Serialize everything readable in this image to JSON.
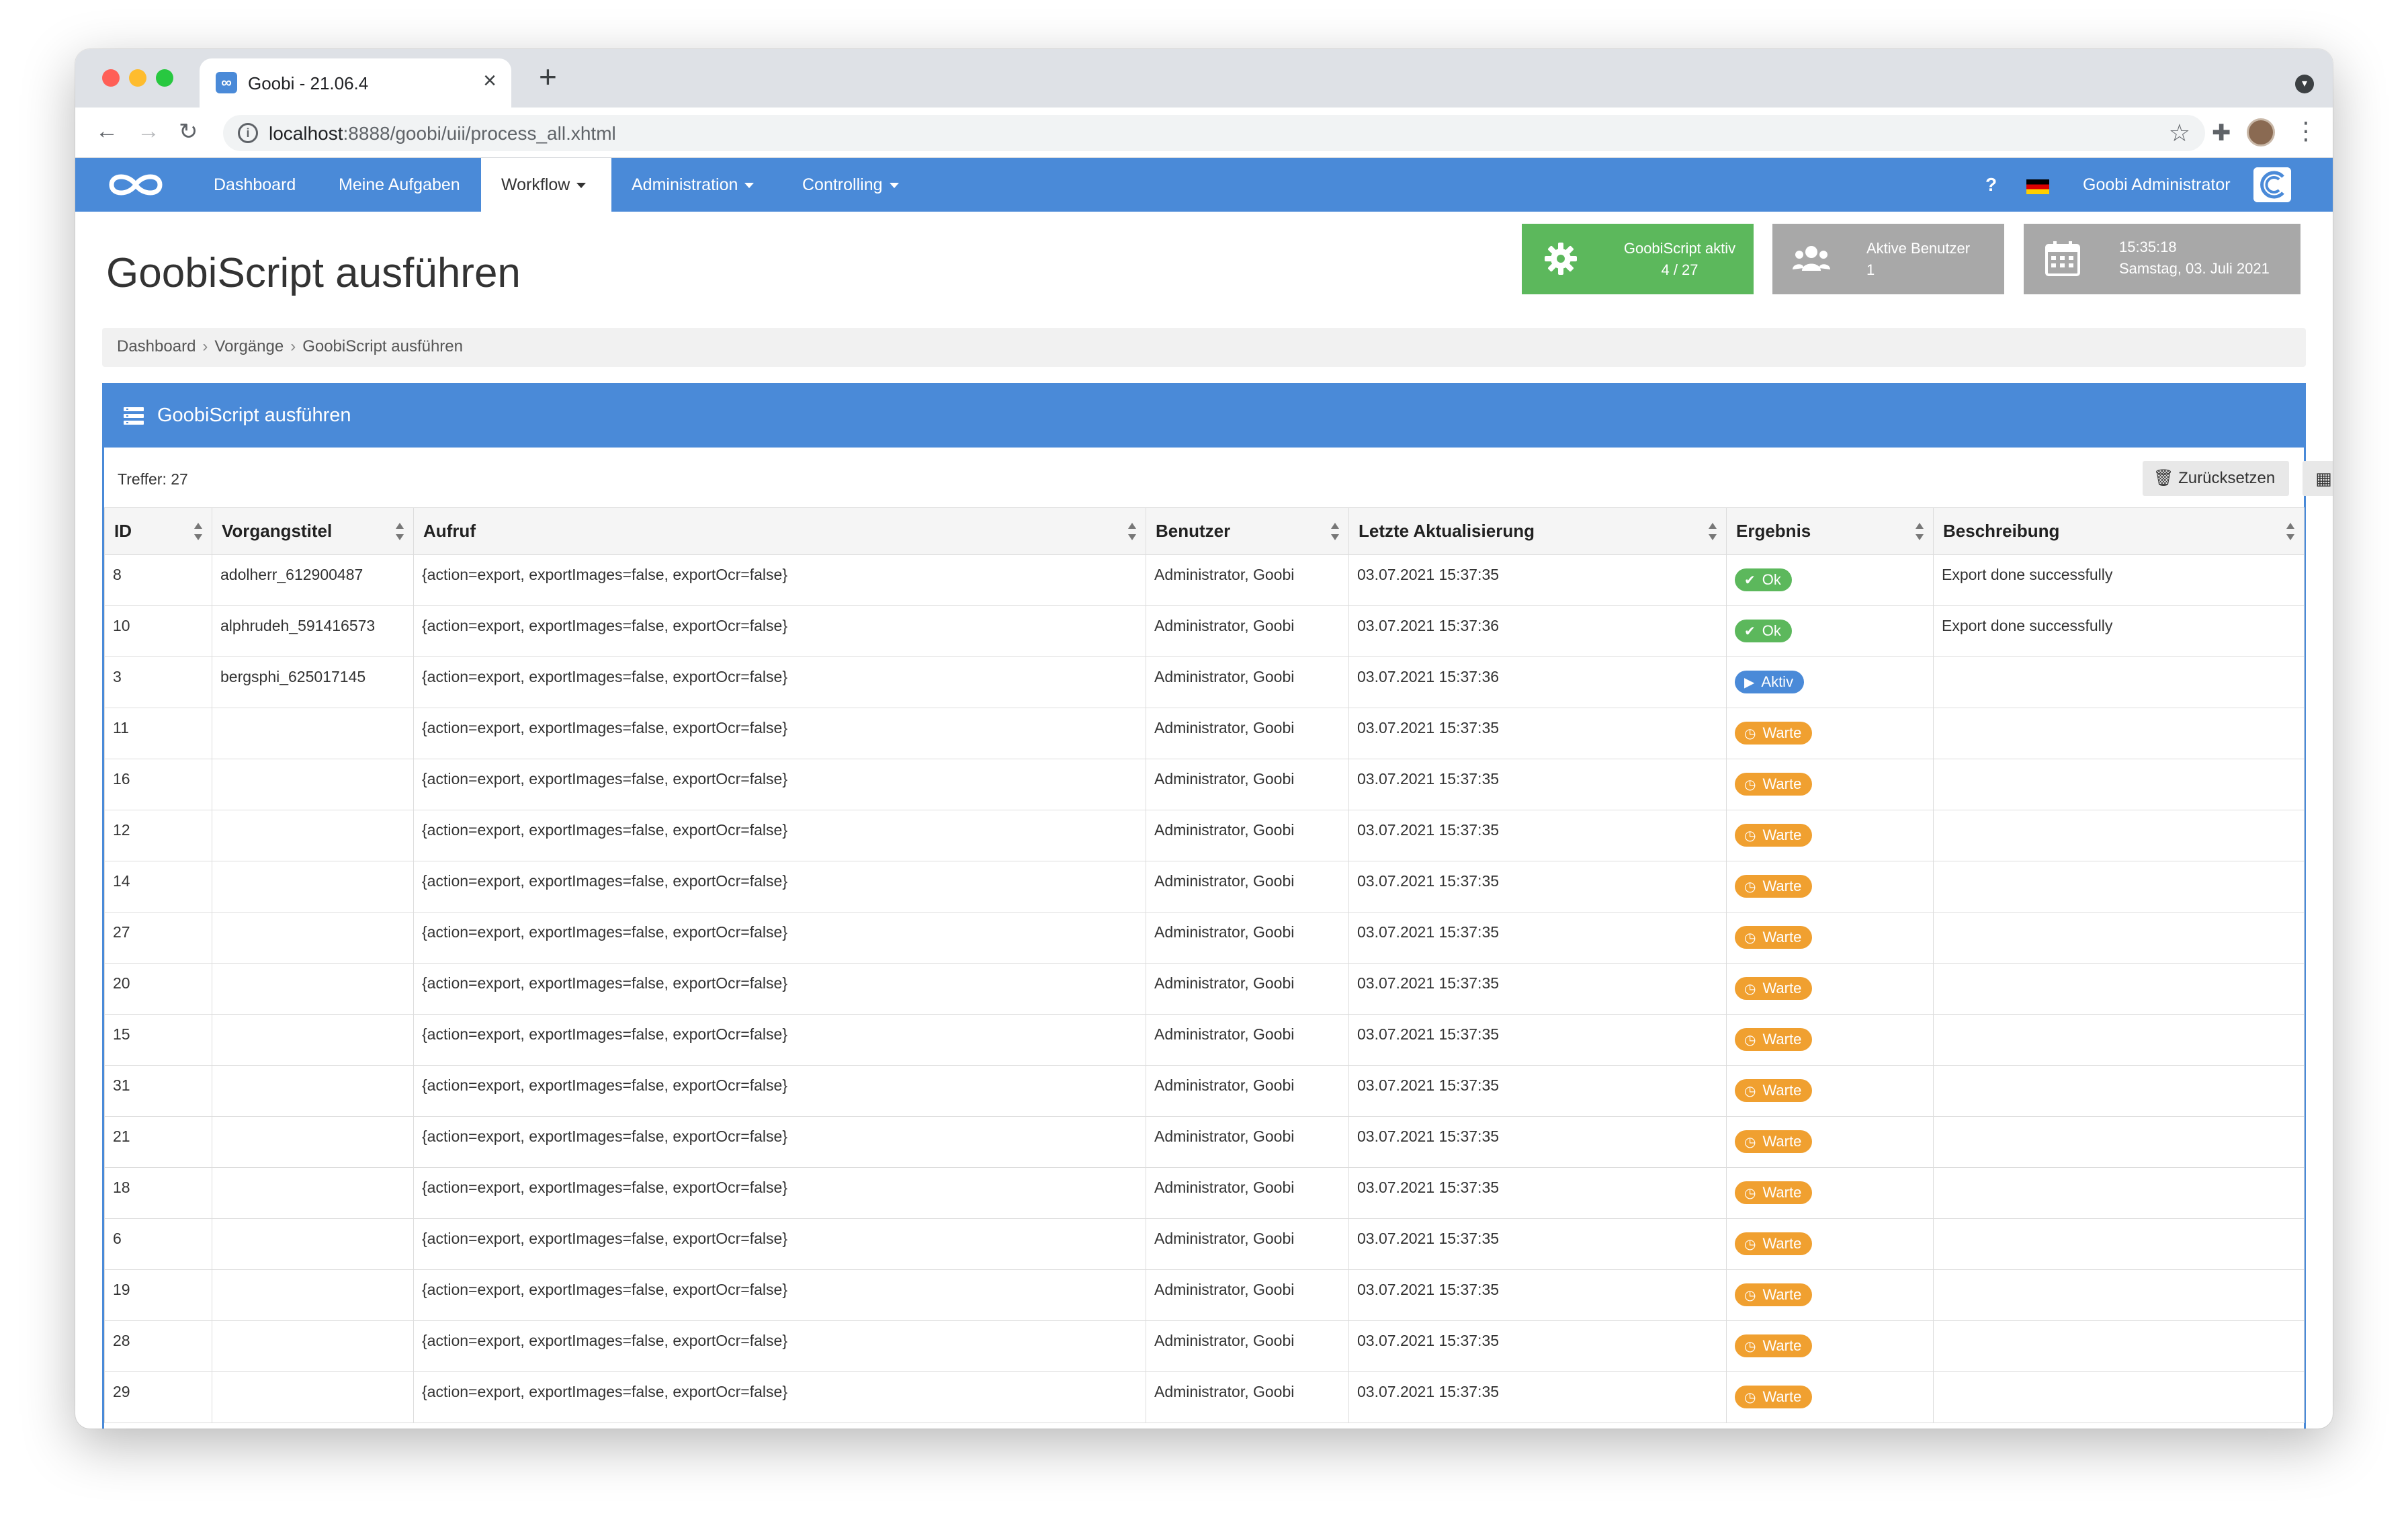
{
  "browser": {
    "tab_title": "Goobi - 21.06.4",
    "url_host": "localhost",
    "url_rest": ":8888/goobi/uii/process_all.xhtml"
  },
  "nav": {
    "items": [
      "Dashboard",
      "Meine Aufgaben",
      "Workflow",
      "Administration",
      "Controlling"
    ],
    "help": "?",
    "user": "Goobi Administrator"
  },
  "page": {
    "title": "GoobiScript ausführen",
    "breadcrumb": [
      "Dashboard",
      "Vorgänge",
      "GoobiScript ausführen"
    ]
  },
  "infoboxes": {
    "script": {
      "label": "GoobiScript aktiv",
      "value": "4 / 27"
    },
    "users": {
      "label": "Aktive Benutzer",
      "value": "1"
    },
    "time": {
      "label": "15:35:18",
      "value": "Samstag, 03. Juli 2021"
    }
  },
  "panel": {
    "title": "GoobiScript ausführen",
    "treffer": "Treffer: 27",
    "reset_label": "Zurücksetzen"
  },
  "table": {
    "columns": [
      "ID",
      "Vorgangstitel",
      "Aufruf",
      "Benutzer",
      "Letzte Aktualisierung",
      "Ergebnis",
      "Beschreibung"
    ],
    "rows": [
      {
        "id": "8",
        "title": "adolherr_612900487",
        "call": "{action=export, exportImages=false, exportOcr=false}",
        "user": "Administrator, Goobi",
        "updated": "03.07.2021 15:37:35",
        "result": "Ok",
        "status": "ok",
        "desc": "Export done successfully"
      },
      {
        "id": "10",
        "title": "alphrudeh_591416573",
        "call": "{action=export, exportImages=false, exportOcr=false}",
        "user": "Administrator, Goobi",
        "updated": "03.07.2021 15:37:36",
        "result": "Ok",
        "status": "ok",
        "desc": "Export done successfully"
      },
      {
        "id": "3",
        "title": "bergsphi_625017145",
        "call": "{action=export, exportImages=false, exportOcr=false}",
        "user": "Administrator, Goobi",
        "updated": "03.07.2021 15:37:36",
        "result": "Aktiv",
        "status": "aktiv",
        "desc": ""
      },
      {
        "id": "11",
        "title": "",
        "call": "{action=export, exportImages=false, exportOcr=false}",
        "user": "Administrator, Goobi",
        "updated": "03.07.2021 15:37:35",
        "result": "Warte",
        "status": "warte",
        "desc": ""
      },
      {
        "id": "16",
        "title": "",
        "call": "{action=export, exportImages=false, exportOcr=false}",
        "user": "Administrator, Goobi",
        "updated": "03.07.2021 15:37:35",
        "result": "Warte",
        "status": "warte",
        "desc": ""
      },
      {
        "id": "12",
        "title": "",
        "call": "{action=export, exportImages=false, exportOcr=false}",
        "user": "Administrator, Goobi",
        "updated": "03.07.2021 15:37:35",
        "result": "Warte",
        "status": "warte",
        "desc": ""
      },
      {
        "id": "14",
        "title": "",
        "call": "{action=export, exportImages=false, exportOcr=false}",
        "user": "Administrator, Goobi",
        "updated": "03.07.2021 15:37:35",
        "result": "Warte",
        "status": "warte",
        "desc": ""
      },
      {
        "id": "27",
        "title": "",
        "call": "{action=export, exportImages=false, exportOcr=false}",
        "user": "Administrator, Goobi",
        "updated": "03.07.2021 15:37:35",
        "result": "Warte",
        "status": "warte",
        "desc": ""
      },
      {
        "id": "20",
        "title": "",
        "call": "{action=export, exportImages=false, exportOcr=false}",
        "user": "Administrator, Goobi",
        "updated": "03.07.2021 15:37:35",
        "result": "Warte",
        "status": "warte",
        "desc": ""
      },
      {
        "id": "15",
        "title": "",
        "call": "{action=export, exportImages=false, exportOcr=false}",
        "user": "Administrator, Goobi",
        "updated": "03.07.2021 15:37:35",
        "result": "Warte",
        "status": "warte",
        "desc": ""
      },
      {
        "id": "31",
        "title": "",
        "call": "{action=export, exportImages=false, exportOcr=false}",
        "user": "Administrator, Goobi",
        "updated": "03.07.2021 15:37:35",
        "result": "Warte",
        "status": "warte",
        "desc": ""
      },
      {
        "id": "21",
        "title": "",
        "call": "{action=export, exportImages=false, exportOcr=false}",
        "user": "Administrator, Goobi",
        "updated": "03.07.2021 15:37:35",
        "result": "Warte",
        "status": "warte",
        "desc": ""
      },
      {
        "id": "18",
        "title": "",
        "call": "{action=export, exportImages=false, exportOcr=false}",
        "user": "Administrator, Goobi",
        "updated": "03.07.2021 15:37:35",
        "result": "Warte",
        "status": "warte",
        "desc": ""
      },
      {
        "id": "6",
        "title": "",
        "call": "{action=export, exportImages=false, exportOcr=false}",
        "user": "Administrator, Goobi",
        "updated": "03.07.2021 15:37:35",
        "result": "Warte",
        "status": "warte",
        "desc": ""
      },
      {
        "id": "19",
        "title": "",
        "call": "{action=export, exportImages=false, exportOcr=false}",
        "user": "Administrator, Goobi",
        "updated": "03.07.2021 15:37:35",
        "result": "Warte",
        "status": "warte",
        "desc": ""
      },
      {
        "id": "28",
        "title": "",
        "call": "{action=export, exportImages=false, exportOcr=false}",
        "user": "Administrator, Goobi",
        "updated": "03.07.2021 15:37:35",
        "result": "Warte",
        "status": "warte",
        "desc": ""
      },
      {
        "id": "29",
        "title": "",
        "call": "{action=export, exportImages=false, exportOcr=false}",
        "user": "Administrator, Goobi",
        "updated": "03.07.2021 15:37:35",
        "result": "Warte",
        "status": "warte",
        "desc": ""
      }
    ]
  },
  "colors": {
    "brand_blue": "#4a8ad8",
    "ok_green": "#5cb85c",
    "warte_orange": "#f0a030",
    "infobox_grey": "#a8a8a8"
  },
  "icons": {
    "ok": "check-icon",
    "aktiv": "play-icon",
    "warte": "clock-icon"
  }
}
